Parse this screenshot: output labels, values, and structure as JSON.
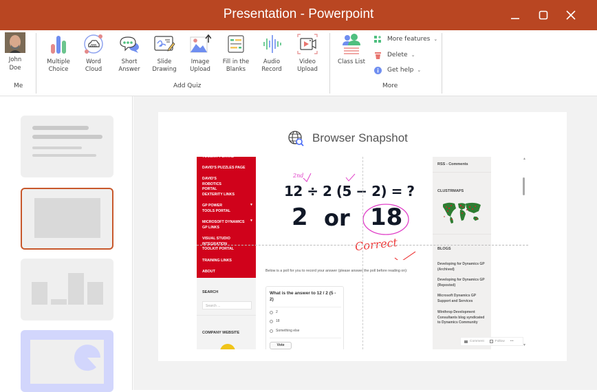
{
  "window": {
    "title": "Presentation - Powerpoint",
    "controls": {
      "minimize": "_",
      "maximize": "▢",
      "close": "✕"
    },
    "accent": "#b94622"
  },
  "ribbon": {
    "user": {
      "first": "John",
      "last": "Doe",
      "group_label": "Me"
    },
    "add_quiz": {
      "group_label": "Add Quiz",
      "buttons": [
        {
          "line1": "Multiple",
          "line2": "Choice",
          "icon": "bar-chart-icon"
        },
        {
          "line1": "Word",
          "line2": "Cloud",
          "icon": "word-cloud-icon"
        },
        {
          "line1": "Short",
          "line2": "Answer",
          "icon": "chat-bubbles-icon"
        },
        {
          "line1": "Slide",
          "line2": "Drawing",
          "icon": "slide-drawing-icon"
        },
        {
          "line1": "Image",
          "line2": "Upload",
          "icon": "image-upload-icon"
        },
        {
          "line1": "Fill in the",
          "line2": "Blanks",
          "icon": "fill-blanks-icon"
        },
        {
          "line1": "Audio",
          "line2": "Record",
          "icon": "audio-wave-icon"
        },
        {
          "line1": "Video",
          "line2": "Upload",
          "icon": "video-upload-icon"
        }
      ]
    },
    "more": {
      "group_label": "More",
      "class_list": "Class List",
      "items": [
        {
          "label": "More features",
          "icon": "add-grid-icon"
        },
        {
          "label": "Delete",
          "icon": "trash-icon"
        },
        {
          "label": "Get help",
          "icon": "info-icon"
        }
      ],
      "chevron": "⌄"
    }
  },
  "slides": {
    "count": 4,
    "selected_index": 1
  },
  "slide": {
    "title": "Browser Snapshot",
    "browser": {
      "menu_items": [
        "TOOLKIT PORTAL",
        "DAVID'S PUZZLES PAGE",
        "DAVID'S ROBOTICS PORTAL",
        "DEXTERITY LINKS",
        "GP POWER TOOLS PORTAL",
        "MICROSOFT DYNAMICS GP LINKS",
        "VISUAL STUDIO INTEGRATION TOOLKIT PORTAL",
        "TRAINING LINKS",
        "ABOUT"
      ],
      "search_heading": "SEARCH",
      "search_placeholder": "Search ...",
      "company_heading": "COMPANY WEBSITE",
      "puzzle_line1": "12 ÷ 2 (5 − 2) = ?",
      "puzzle_opt1": "2",
      "puzzle_or": "or",
      "puzzle_opt2": "18",
      "annotation_correct": "Correct",
      "annotation_2nd": "2nd",
      "poll_intro": "Below is a poll for you to record your answer (please answer the poll before reading on):",
      "poll_question": "What is the answer to 12 / 2 (5 - 2)",
      "poll_options": [
        "2",
        "18",
        "Something else"
      ],
      "vote_label": "Vote",
      "right": {
        "rss": "RSS - Comments",
        "clustrmaps": "CLUSTRMAPS",
        "blogs": "BLOGS",
        "blog_links": [
          "Developing for Dynamics GP (Archived)",
          "Developing for Dynamics GP (Reposted)",
          "Microsoft Dynamics GP Support and Services",
          "Winthrop Development Consultants blog syndicated to Dynamics Community"
        ]
      },
      "footer": {
        "comment": "Comment",
        "follow": "Follow",
        "more": "•••"
      }
    }
  }
}
